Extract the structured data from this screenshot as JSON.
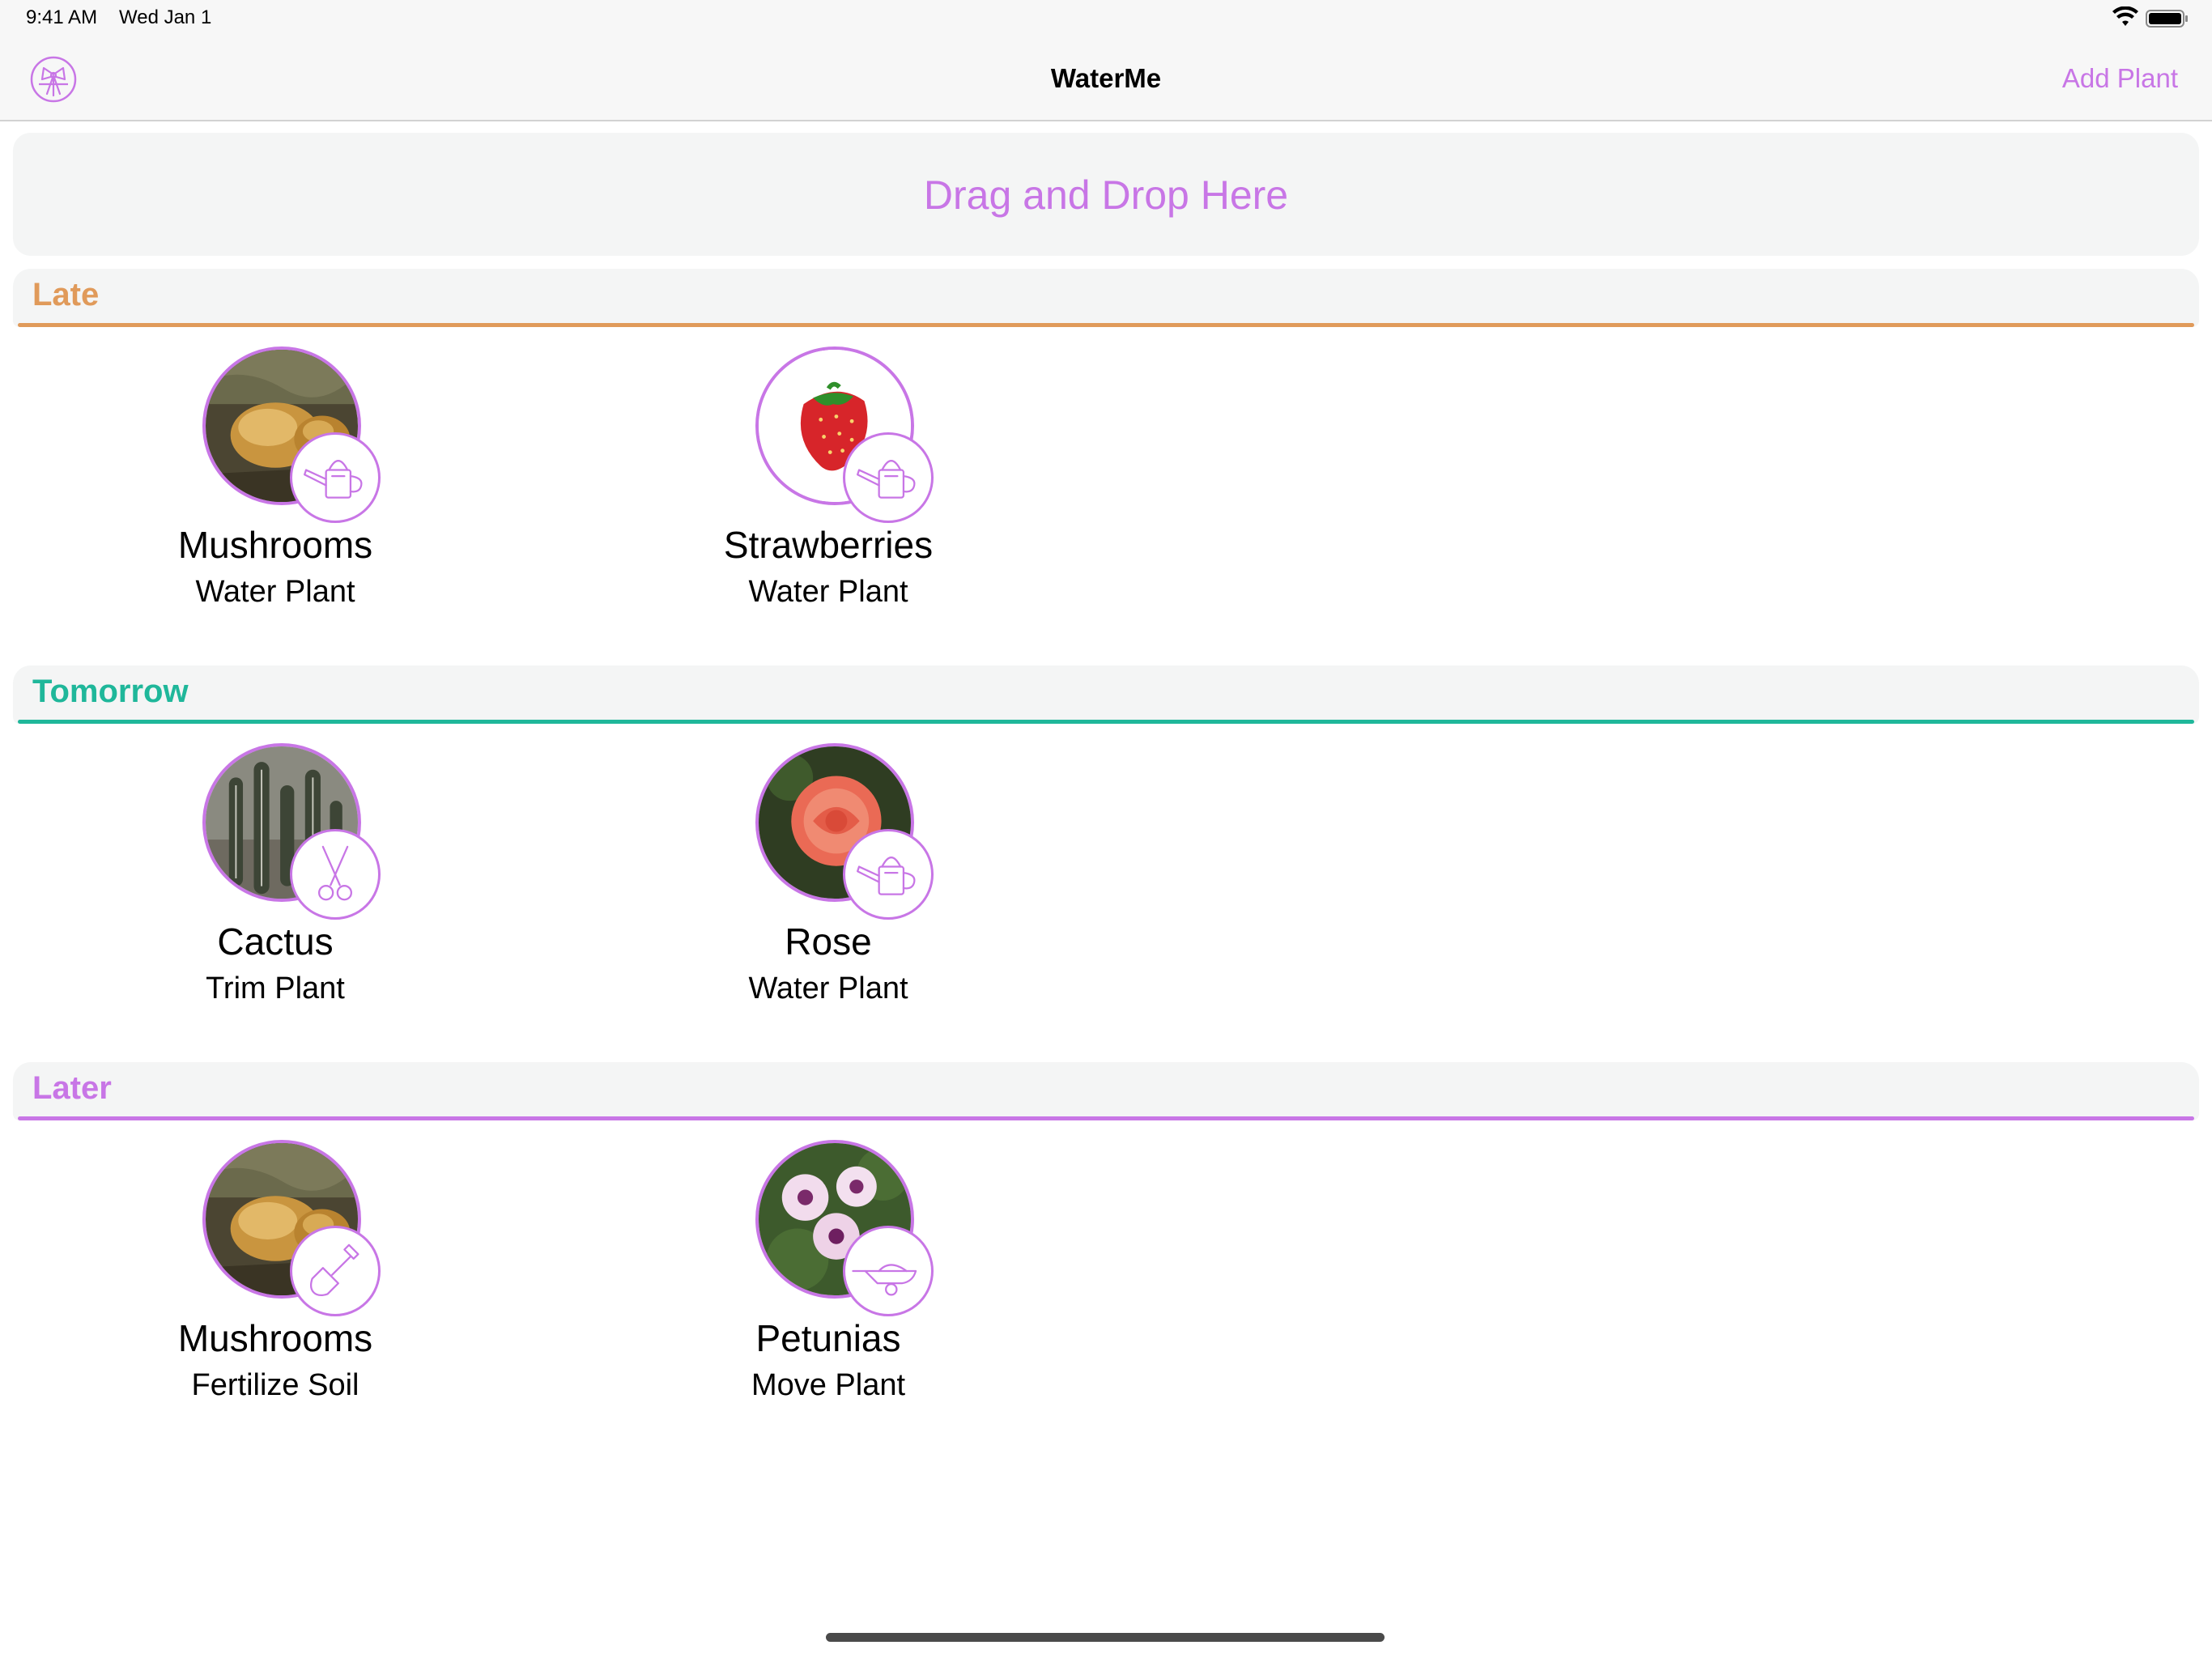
{
  "status_bar": {
    "time": "9:41 AM",
    "date": "Wed Jan 1"
  },
  "nav": {
    "title": "WaterMe",
    "add_button": "Add Plant",
    "left_icon": "bow-icon"
  },
  "drop_zone": {
    "label": "Drag and Drop Here"
  },
  "colors": {
    "accent": "#c876e6",
    "late": "#e09a5a",
    "tomorrow": "#1fb79a",
    "later": "#c876e6"
  },
  "sections": [
    {
      "title": "Late",
      "items": [
        {
          "name": "Mushrooms",
          "task": "Water Plant",
          "icon": "watering-can-icon"
        },
        {
          "name": "Strawberries",
          "task": "Water Plant",
          "icon": "watering-can-icon"
        }
      ]
    },
    {
      "title": "Tomorrow",
      "items": [
        {
          "name": "Cactus",
          "task": "Trim Plant",
          "icon": "scissors-icon"
        },
        {
          "name": "Rose",
          "task": "Water Plant",
          "icon": "watering-can-icon"
        }
      ]
    },
    {
      "title": "Later",
      "items": [
        {
          "name": "Mushrooms",
          "task": "Fertilize Soil",
          "icon": "shovel-icon"
        },
        {
          "name": "Petunias",
          "task": "Move Plant",
          "icon": "wheelbarrow-icon"
        }
      ]
    }
  ]
}
